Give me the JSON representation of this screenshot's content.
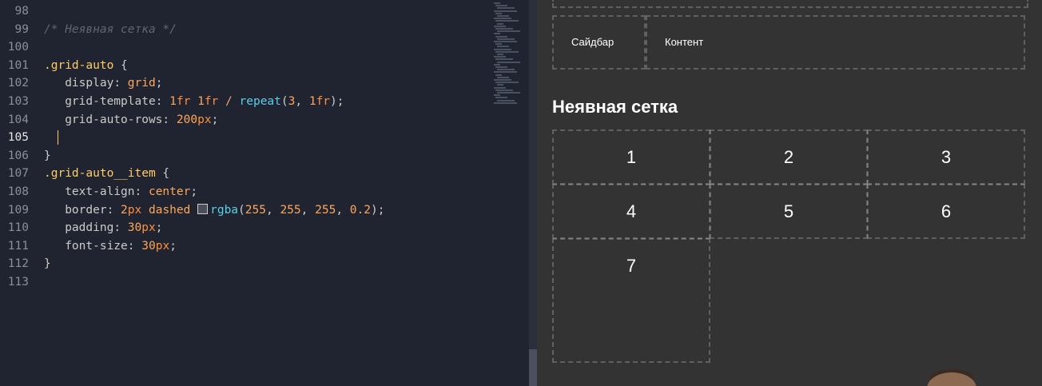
{
  "editor": {
    "lines": [
      {
        "num": "98",
        "tokens": []
      },
      {
        "num": "99",
        "tokens": [
          [
            "comment",
            "/* Неявная сетка */"
          ]
        ]
      },
      {
        "num": "100",
        "tokens": []
      },
      {
        "num": "101",
        "tokens": [
          [
            "selector",
            ".grid-auto"
          ],
          [
            "punct",
            " {"
          ]
        ]
      },
      {
        "num": "102",
        "tokens": [
          [
            "guide",
            "→ "
          ],
          [
            "prop",
            " display"
          ],
          [
            "punct",
            ": "
          ],
          [
            "value",
            "grid"
          ],
          [
            "punct",
            ";"
          ]
        ]
      },
      {
        "num": "103",
        "tokens": [
          [
            "guide",
            "→ "
          ],
          [
            "prop",
            " grid-template"
          ],
          [
            "punct",
            ": "
          ],
          [
            "num",
            "1"
          ],
          [
            "unit",
            "fr"
          ],
          [
            "punct",
            " "
          ],
          [
            "num",
            "1"
          ],
          [
            "unit",
            "fr"
          ],
          [
            "punct",
            " "
          ],
          [
            "op",
            "/"
          ],
          [
            "punct",
            " "
          ],
          [
            "func",
            "repeat"
          ],
          [
            "punct",
            "("
          ],
          [
            "num",
            "3"
          ],
          [
            "punct",
            ", "
          ],
          [
            "num",
            "1"
          ],
          [
            "unit",
            "fr"
          ],
          [
            "punct",
            ");"
          ]
        ]
      },
      {
        "num": "104",
        "tokens": [
          [
            "guide",
            "→ "
          ],
          [
            "prop",
            " grid-auto-rows"
          ],
          [
            "punct",
            ": "
          ],
          [
            "num",
            "200"
          ],
          [
            "unit",
            "px"
          ],
          [
            "punct",
            ";"
          ]
        ]
      },
      {
        "num": "105",
        "active": true,
        "tokens": [
          [
            "guide",
            "→ "
          ],
          [
            "cursor",
            ""
          ]
        ]
      },
      {
        "num": "106",
        "tokens": [
          [
            "punct",
            "}"
          ]
        ]
      },
      {
        "num": "107",
        "tokens": [
          [
            "selector",
            ".grid-auto__item"
          ],
          [
            "punct",
            " {"
          ]
        ]
      },
      {
        "num": "108",
        "tokens": [
          [
            "guide",
            "→ "
          ],
          [
            "prop",
            " text-align"
          ],
          [
            "punct",
            ": "
          ],
          [
            "value",
            "center"
          ],
          [
            "punct",
            ";"
          ]
        ]
      },
      {
        "num": "109",
        "tokens": [
          [
            "guide",
            "→ "
          ],
          [
            "prop",
            " border"
          ],
          [
            "punct",
            ": "
          ],
          [
            "num",
            "2"
          ],
          [
            "unit",
            "px"
          ],
          [
            "punct",
            " "
          ],
          [
            "value",
            "dashed"
          ],
          [
            "punct",
            " "
          ],
          [
            "swatch",
            ""
          ],
          [
            "func",
            "rgba"
          ],
          [
            "punct",
            "("
          ],
          [
            "num",
            "255"
          ],
          [
            "punct",
            ", "
          ],
          [
            "num",
            "255"
          ],
          [
            "punct",
            ", "
          ],
          [
            "num",
            "255"
          ],
          [
            "punct",
            ", "
          ],
          [
            "num",
            "0.2"
          ],
          [
            "punct",
            ");"
          ]
        ]
      },
      {
        "num": "110",
        "tokens": [
          [
            "guide",
            "→ "
          ],
          [
            "prop",
            " padding"
          ],
          [
            "punct",
            ": "
          ],
          [
            "num",
            "30"
          ],
          [
            "unit",
            "px"
          ],
          [
            "punct",
            ";"
          ]
        ]
      },
      {
        "num": "111",
        "tokens": [
          [
            "guide",
            "→ "
          ],
          [
            "prop",
            " font-size"
          ],
          [
            "punct",
            ": "
          ],
          [
            "num",
            "30"
          ],
          [
            "unit",
            "px"
          ],
          [
            "punct",
            ";"
          ]
        ]
      },
      {
        "num": "112",
        "tokens": [
          [
            "punct",
            "}"
          ]
        ]
      },
      {
        "num": "113",
        "tokens": []
      }
    ]
  },
  "preview": {
    "grid1": {
      "sidebar_label": "Сайдбар",
      "content_label": "Контент"
    },
    "section_title": "Неявная сетка",
    "grid_items": [
      "1",
      "2",
      "3",
      "4",
      "5",
      "6",
      "7"
    ]
  },
  "colors": {
    "editor_bg": "#1f2430",
    "preview_bg": "#333333",
    "selector": "#ffcc66",
    "number": "#ffa759",
    "function": "#5ccfe6",
    "comment": "#5c6773"
  }
}
